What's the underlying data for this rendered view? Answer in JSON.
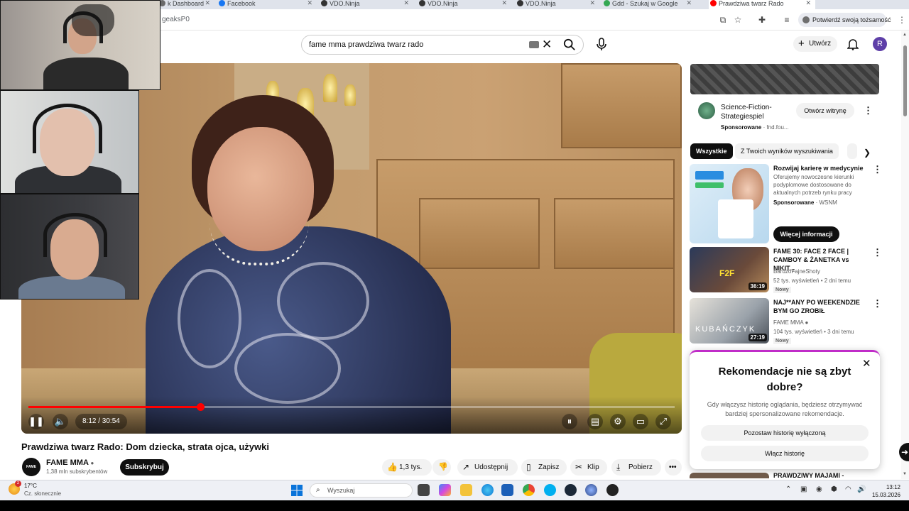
{
  "browser": {
    "tabs": [
      {
        "label": "k Dashboard",
        "color": "#6a6a6a"
      },
      {
        "label": "Facebook",
        "color": "#1877f2"
      },
      {
        "label": "VDO.Ninja",
        "color": "#333333"
      },
      {
        "label": "VDO.Ninja",
        "color": "#333333"
      },
      {
        "label": "VDO.Ninja",
        "color": "#333333"
      },
      {
        "label": "Gdd - Szukaj w Google",
        "color": "#34a853"
      },
      {
        "label": "VDO.Ninja",
        "color": "#333333"
      },
      {
        "label": "Prawdziwa twarz Rado",
        "color": "#ff0000"
      }
    ],
    "url_fragment": "geaksP0",
    "verify_label": "Potwierdź swoją tożsamość"
  },
  "youtube": {
    "search_query": "fame mma prawdziwa twarz rado",
    "create_label": "Utwórz",
    "avatar_letter": "R"
  },
  "video": {
    "time": "8:12 / 30:54",
    "progress_fraction": 0.2655,
    "title": "Prawdziwa twarz Rado: Dom dziecka, strata ojca, używki",
    "channel": "FAME MMA",
    "channel_logo_text": "FAME",
    "subscribers": "1,38 mln subskrybentów",
    "subscribe_label": "Subskrybuj",
    "likes": "1,3 tys.",
    "actions": {
      "share": "Udostępnij",
      "save": "Zapisz",
      "clip": "Klip",
      "download": "Pobierz"
    }
  },
  "sidebar": {
    "ad": {
      "title": "Science-Fiction-Strategiespiel",
      "sponsored": "Sponsorowane",
      "domain": "fnd.fou...",
      "open_label": "Otwórz witrynę"
    },
    "chips": [
      "Wszystkie",
      "Z Twoich wyników wyszukiwania"
    ],
    "recs": [
      {
        "title": "Rozwijaj karierę w medycynie",
        "desc": "Oferujemy nowoczesne kierunki podyplomowe dostosowane do aktualnych potrzeb rynku pracy",
        "sponsored": "Sponsorowane",
        "advertiser": "WSNM",
        "cta": "Więcej informacji"
      },
      {
        "title": "FAME 30: FACE 2 FACE | CAMBOY & ŻANETKA vs NIKIT...",
        "channel": "BardzoFajneShoty",
        "meta": "52 tys. wyświetleń • 2 dni temu",
        "badge": "Nowy",
        "duration": "36:19"
      },
      {
        "title": "NAJ**ANY PO WEEKENDZIE BYM GO ZROBIŁ",
        "channel": "FAME MMA",
        "meta": "104 tys. wyświetleń • 3 dni temu",
        "badge": "Nowy",
        "duration": "27:19"
      }
    ],
    "popup": {
      "title": "Rekomendacje nie są zbyt dobre?",
      "desc": "Gdy włączysz historię oglądania, będziesz otrzymywać bardziej spersonalizowane rekomendacje.",
      "btn_keep": "Pozostaw historię wyłączoną",
      "btn_enable": "Włącz historię"
    },
    "next_title": "PRAWDZIWY MAJAMI -"
  },
  "taskbar": {
    "weather_temp": "17°C",
    "weather_desc": "Cz. słonecznie",
    "weather_badge": "2",
    "search_placeholder": "Wyszukaj",
    "time": "13:12",
    "date": "15.03.2026"
  }
}
